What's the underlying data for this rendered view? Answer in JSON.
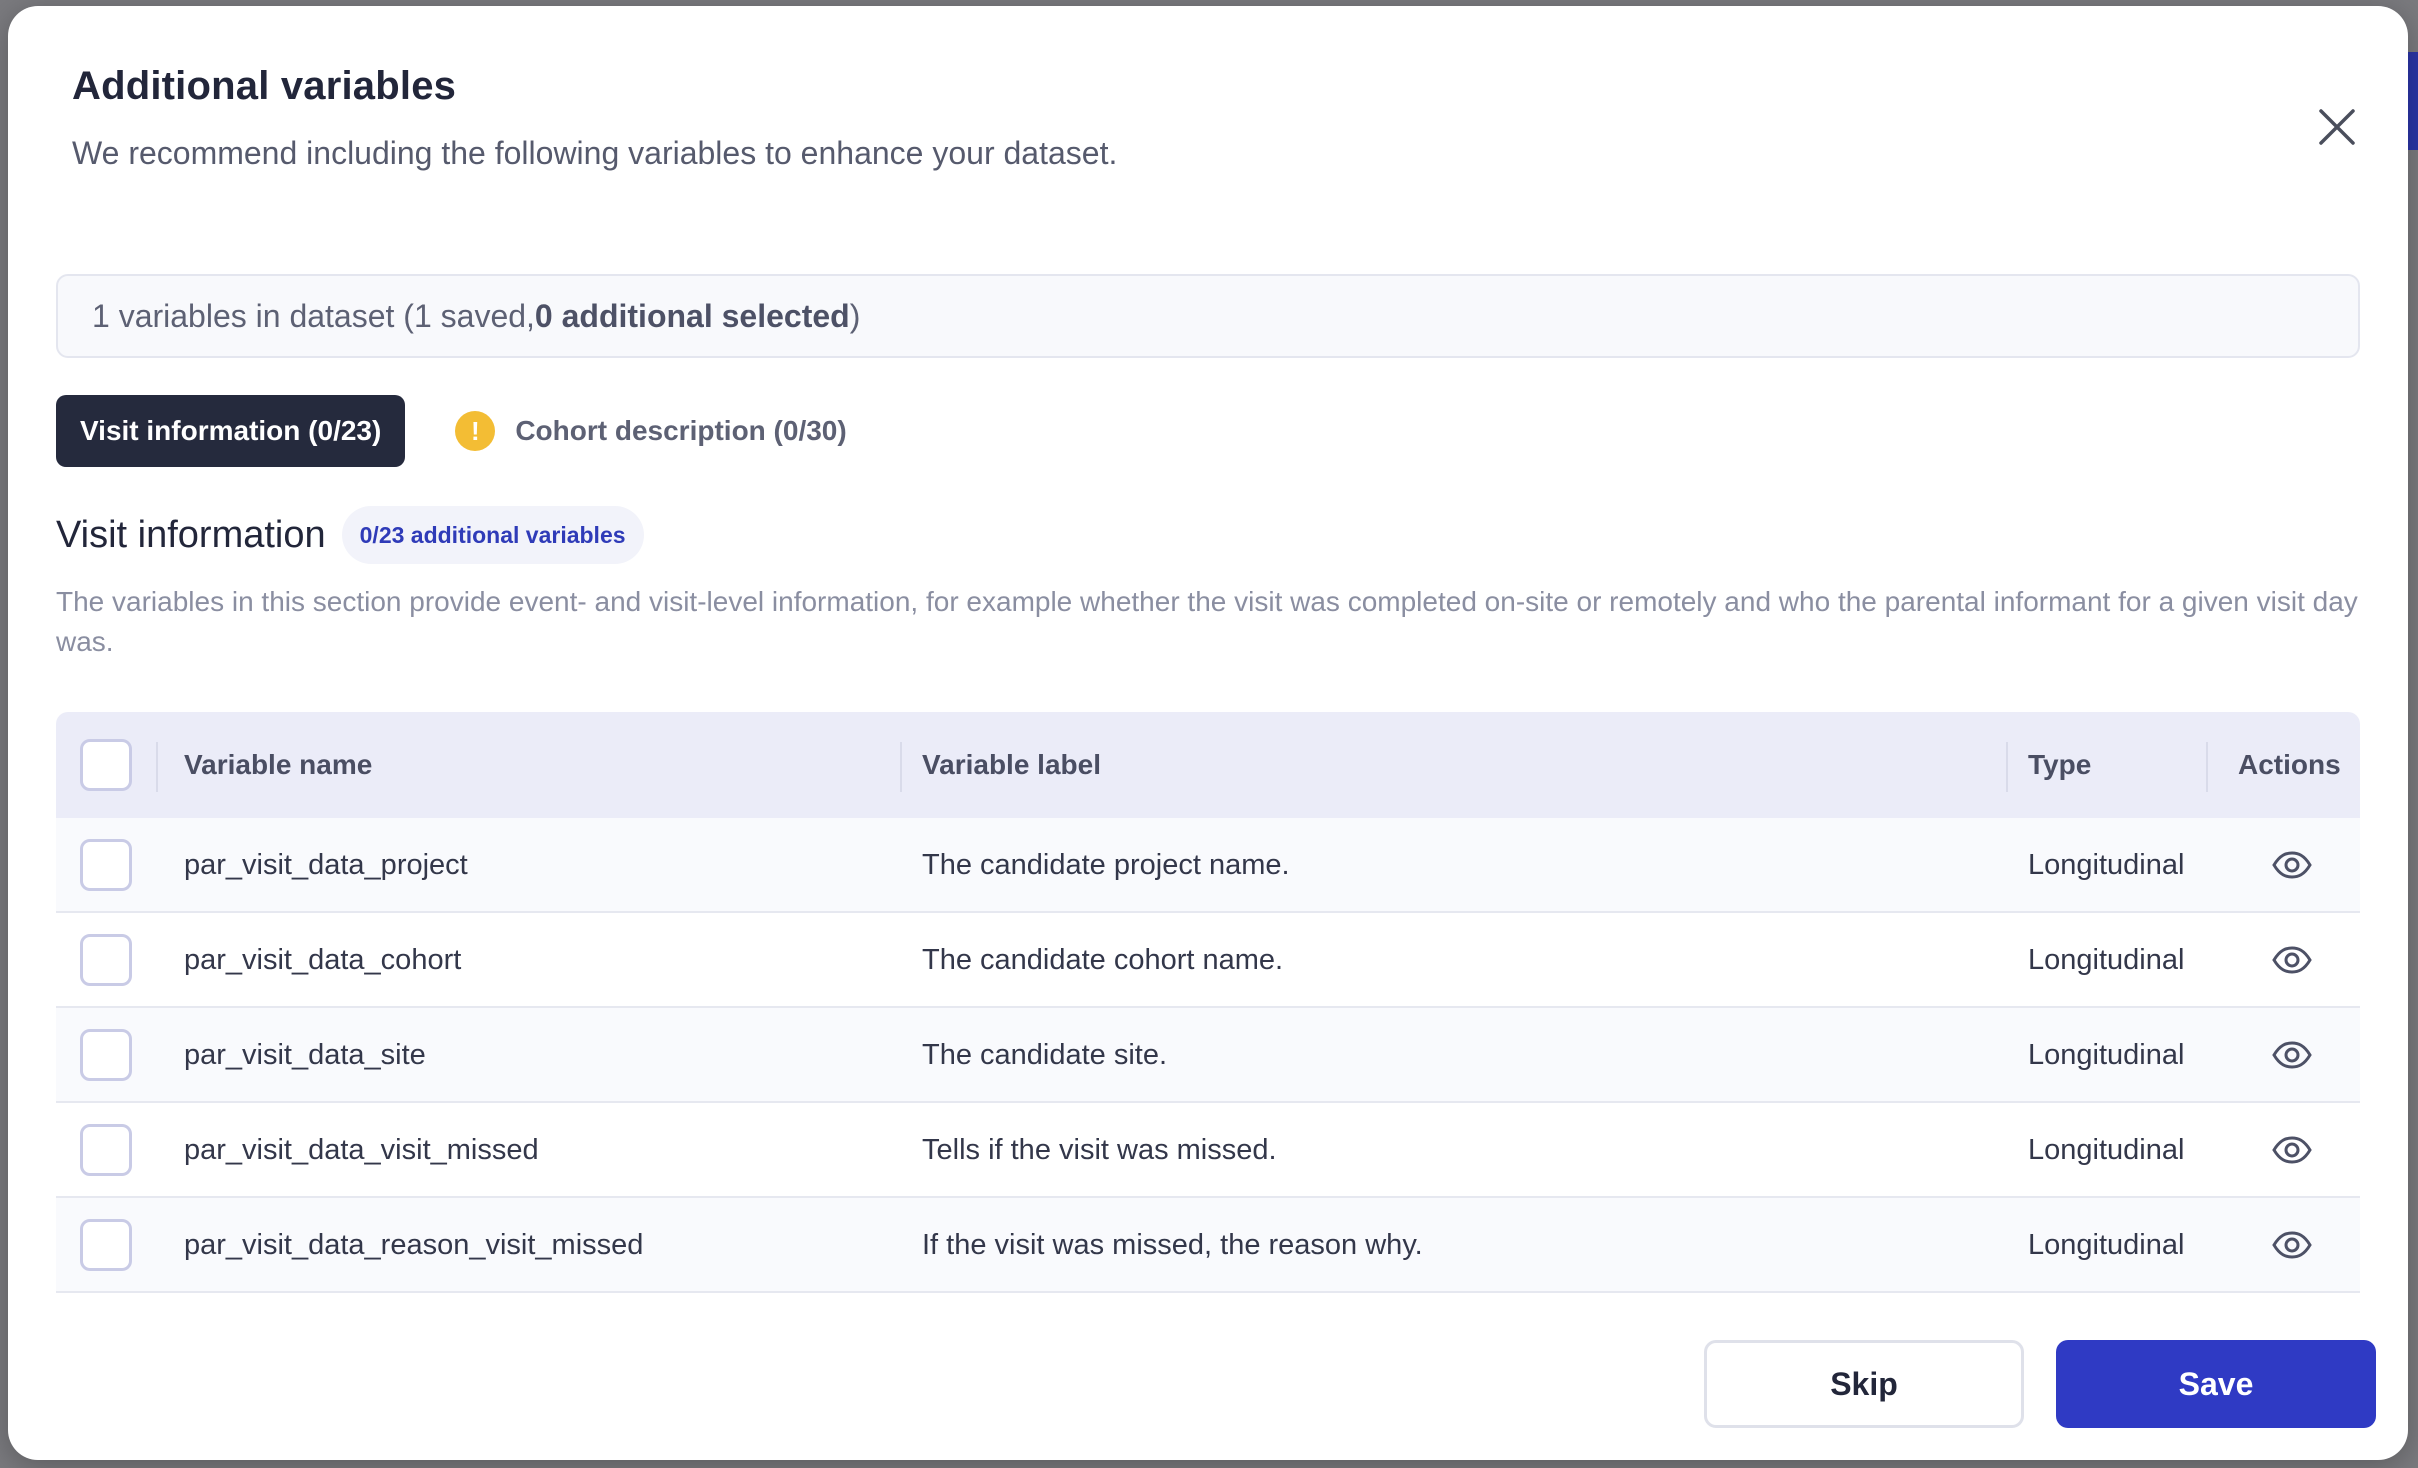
{
  "modal": {
    "title": "Additional variables",
    "subtitle": "We recommend including the following variables to enhance your dataset."
  },
  "summary": {
    "prefix": "1 variables in dataset (1 saved, ",
    "bold": "0 additional selected",
    "suffix": ")"
  },
  "tabs": [
    {
      "label": "Visit information (0/23)",
      "active": true
    },
    {
      "label": "Cohort description (0/30)",
      "active": false,
      "icon": "warning-icon"
    }
  ],
  "section": {
    "title": "Visit information",
    "badge": "0/23 additional variables",
    "description": "The variables in this section provide event- and visit-level information, for example whether the visit was completed on-site or remotely and who the parental informant for a given visit day was."
  },
  "table": {
    "headers": {
      "name": "Variable name",
      "label": "Variable label",
      "type": "Type",
      "actions": "Actions"
    },
    "rows": [
      {
        "name": "par_visit_data_project",
        "label": "The candidate project name.",
        "type": "Longitudinal"
      },
      {
        "name": "par_visit_data_cohort",
        "label": "The candidate cohort name.",
        "type": "Longitudinal"
      },
      {
        "name": "par_visit_data_site",
        "label": "The candidate site.",
        "type": "Longitudinal"
      },
      {
        "name": "par_visit_data_visit_missed",
        "label": "Tells if the visit was missed.",
        "type": "Longitudinal"
      },
      {
        "name": "par_visit_data_reason_visit_missed",
        "label": "If the visit was missed, the reason why.",
        "type": "Longitudinal"
      }
    ]
  },
  "footer": {
    "skip_label": "Skip",
    "save_label": "Save"
  },
  "colors": {
    "primary": "#2f3ac4",
    "dark": "#252a3d",
    "warning": "#f3bd34"
  }
}
